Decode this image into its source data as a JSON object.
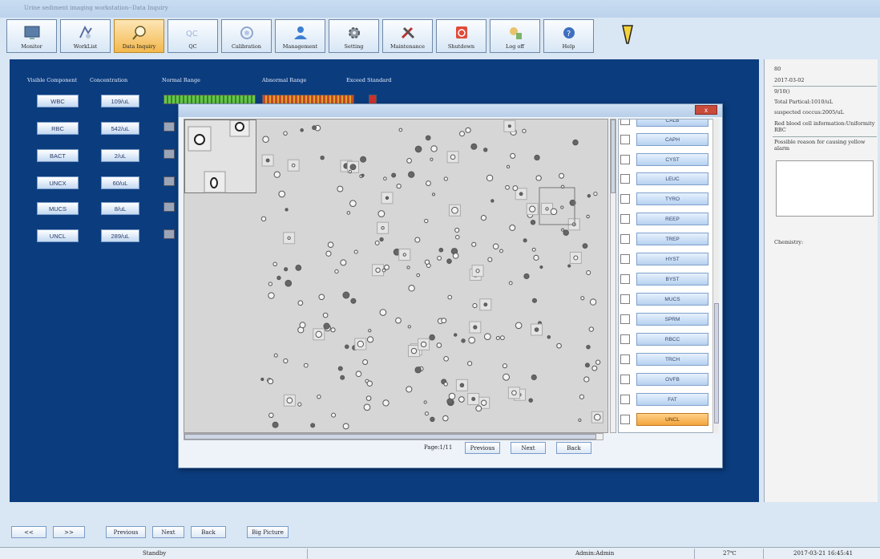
{
  "window_title": "Urine sediment imaging workstation--Data Inquiry",
  "toolbar": [
    {
      "label": "Monitor",
      "icon": "monitor-icon"
    },
    {
      "label": "WorkList",
      "icon": "worklist-icon"
    },
    {
      "label": "Data Inquiry",
      "icon": "magnifier-icon"
    },
    {
      "label": "QC",
      "icon": "qc-icon"
    },
    {
      "label": "Calibration",
      "icon": "calibration-icon"
    },
    {
      "label": "Management",
      "icon": "user-icon"
    },
    {
      "label": "Setting",
      "icon": "gear-icon"
    },
    {
      "label": "Maintenance",
      "icon": "tools-icon"
    },
    {
      "label": "Shutdown",
      "icon": "power-icon"
    },
    {
      "label": "Log off",
      "icon": "logoff-icon"
    },
    {
      "label": "Help",
      "icon": "help-icon"
    }
  ],
  "headers": {
    "visible_component": "Visible Component",
    "concentration": "Concentration",
    "normal_range": "Normal Range",
    "abnormal_range": "Abnormal Range",
    "exceed_standard": "Exceed Standard"
  },
  "components": [
    {
      "name": "WBC",
      "value": "109/uL"
    },
    {
      "name": "RBC",
      "value": "542/uL"
    },
    {
      "name": "BACT",
      "value": "2/uL"
    },
    {
      "name": "UNCX",
      "value": "60/uL"
    },
    {
      "name": "MUCS",
      "value": "8/uL"
    },
    {
      "name": "UNCL",
      "value": "289/uL"
    }
  ],
  "right_panel": {
    "id": "80",
    "date": "2017-03-02",
    "field": "9/10()",
    "total_particle": "Total Partical:1010/uL",
    "suspected": "suspected coccus:2005/uL",
    "rbc_info": "Red blood cell information:Uniformity RBC",
    "alarm_reason": "Possible reason for causing yellow alarm",
    "chemistry": "Chemistry:"
  },
  "modal": {
    "close_label": "x",
    "page_text": "Page:1/11",
    "previous": "Previous",
    "next": "Next",
    "back": "Back"
  },
  "component_list": [
    "CALB",
    "CAPH",
    "CYST",
    "LEUC",
    "TYRO",
    "REEP",
    "TREP",
    "HYST",
    "BYST",
    "MUCS",
    "SPRM",
    "RBCC",
    "TRCH",
    "OVFB",
    "FAT",
    "UNCL"
  ],
  "selected_component": "UNCL",
  "bottom_nav": {
    "first": "<<",
    "last": ">>",
    "previous": "Previous",
    "next": "Next",
    "back": "Back",
    "big_picture": "Big Picture"
  },
  "status_bar": {
    "state": "Standby",
    "user": "Admin:Admin",
    "temperature": "27℃",
    "datetime": "2017-03-21 16:45:41"
  }
}
